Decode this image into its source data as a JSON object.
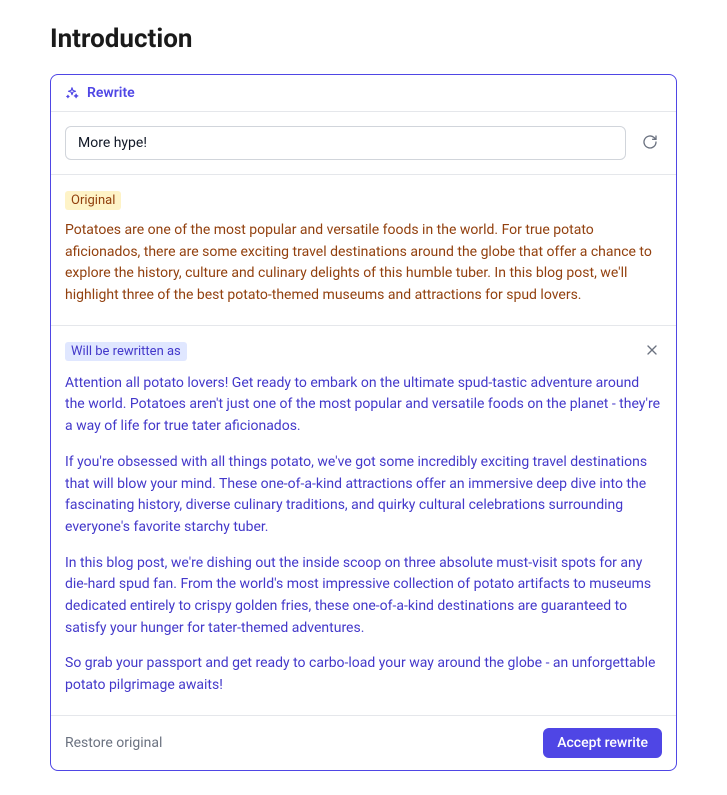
{
  "page": {
    "title": "Introduction"
  },
  "rewrite": {
    "header_label": "Rewrite",
    "prompt_value": "More hype!",
    "original": {
      "badge": "Original",
      "text": "Potatoes are one of the most popular and versatile foods in the world. For true potato aficionados, there are some exciting travel destinations around the globe that offer a chance to explore the history, culture and culinary delights of this humble tuber. In this blog post, we'll highlight three of the best potato-themed museums and attractions for spud lovers."
    },
    "rewritten": {
      "badge": "Will be rewritten as",
      "paragraphs": [
        "Attention all potato lovers! Get ready to embark on the ultimate spud-tastic adventure around the world. Potatoes aren't just one of the most popular and versatile foods on the planet - they're a way of life for true tater aficionados.",
        "If you're obsessed with all things potato, we've got some incredibly exciting travel destinations that will blow your mind. These one-of-a-kind attractions offer an immersive deep dive into the fascinating history, diverse culinary traditions, and quirky cultural celebrations surrounding everyone's favorite starchy tuber.",
        "In this blog post, we're dishing out the inside scoop on three absolute must-visit spots for any die-hard spud fan. From the world's most impressive collection of potato artifacts to museums dedicated entirely to crispy golden fries, these one-of-a-kind destinations are guaranteed to satisfy your hunger for tater-themed adventures.",
        "So grab your passport and get ready to carbo-load your way around the globe - an unforgettable potato pilgrimage awaits!"
      ]
    },
    "actions": {
      "restore": "Restore original",
      "accept": "Accept rewrite"
    }
  }
}
